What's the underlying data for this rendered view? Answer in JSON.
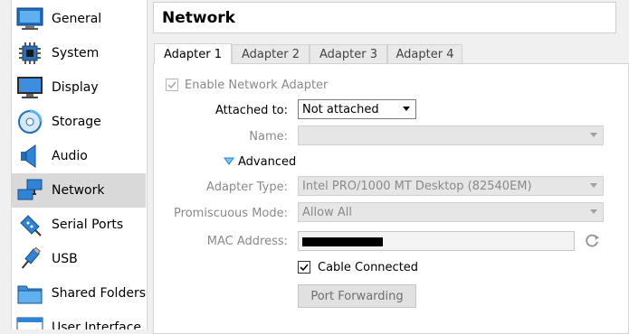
{
  "sidebar": {
    "items": [
      {
        "label": "General",
        "icon": "general-icon"
      },
      {
        "label": "System",
        "icon": "system-icon"
      },
      {
        "label": "Display",
        "icon": "display-icon"
      },
      {
        "label": "Storage",
        "icon": "storage-icon"
      },
      {
        "label": "Audio",
        "icon": "audio-icon"
      },
      {
        "label": "Network",
        "icon": "network-icon",
        "selected": true
      },
      {
        "label": "Serial Ports",
        "icon": "serial-ports-icon"
      },
      {
        "label": "USB",
        "icon": "usb-icon"
      },
      {
        "label": "Shared Folders",
        "icon": "shared-folders-icon"
      },
      {
        "label": "User Interface",
        "icon": "user-interface-icon"
      }
    ]
  },
  "header": {
    "title": "Network"
  },
  "tabs": [
    {
      "label": "Adapter 1",
      "active": true
    },
    {
      "label": "Adapter 2"
    },
    {
      "label": "Adapter 3"
    },
    {
      "label": "Adapter 4"
    }
  ],
  "adapter": {
    "enable_label": "Enable Network Adapter",
    "enable_checked": true,
    "attached_to_label": "Attached to:",
    "attached_to_value": "Not attached",
    "name_label": "Name:",
    "name_value": "",
    "advanced_label": "Advanced",
    "adapter_type_label": "Adapter Type:",
    "adapter_type_value": "Intel PRO/1000 MT Desktop (82540EM)",
    "promiscuous_label": "Promiscuous Mode:",
    "promiscuous_value": "Allow All",
    "mac_label": "MAC Address:",
    "cable_label": "Cable Connected",
    "cable_checked": true,
    "port_forwarding_label": "Port Forwarding"
  },
  "colors": {
    "accent": "#1e8ad6",
    "selected_bg": "#d9d9d9"
  }
}
